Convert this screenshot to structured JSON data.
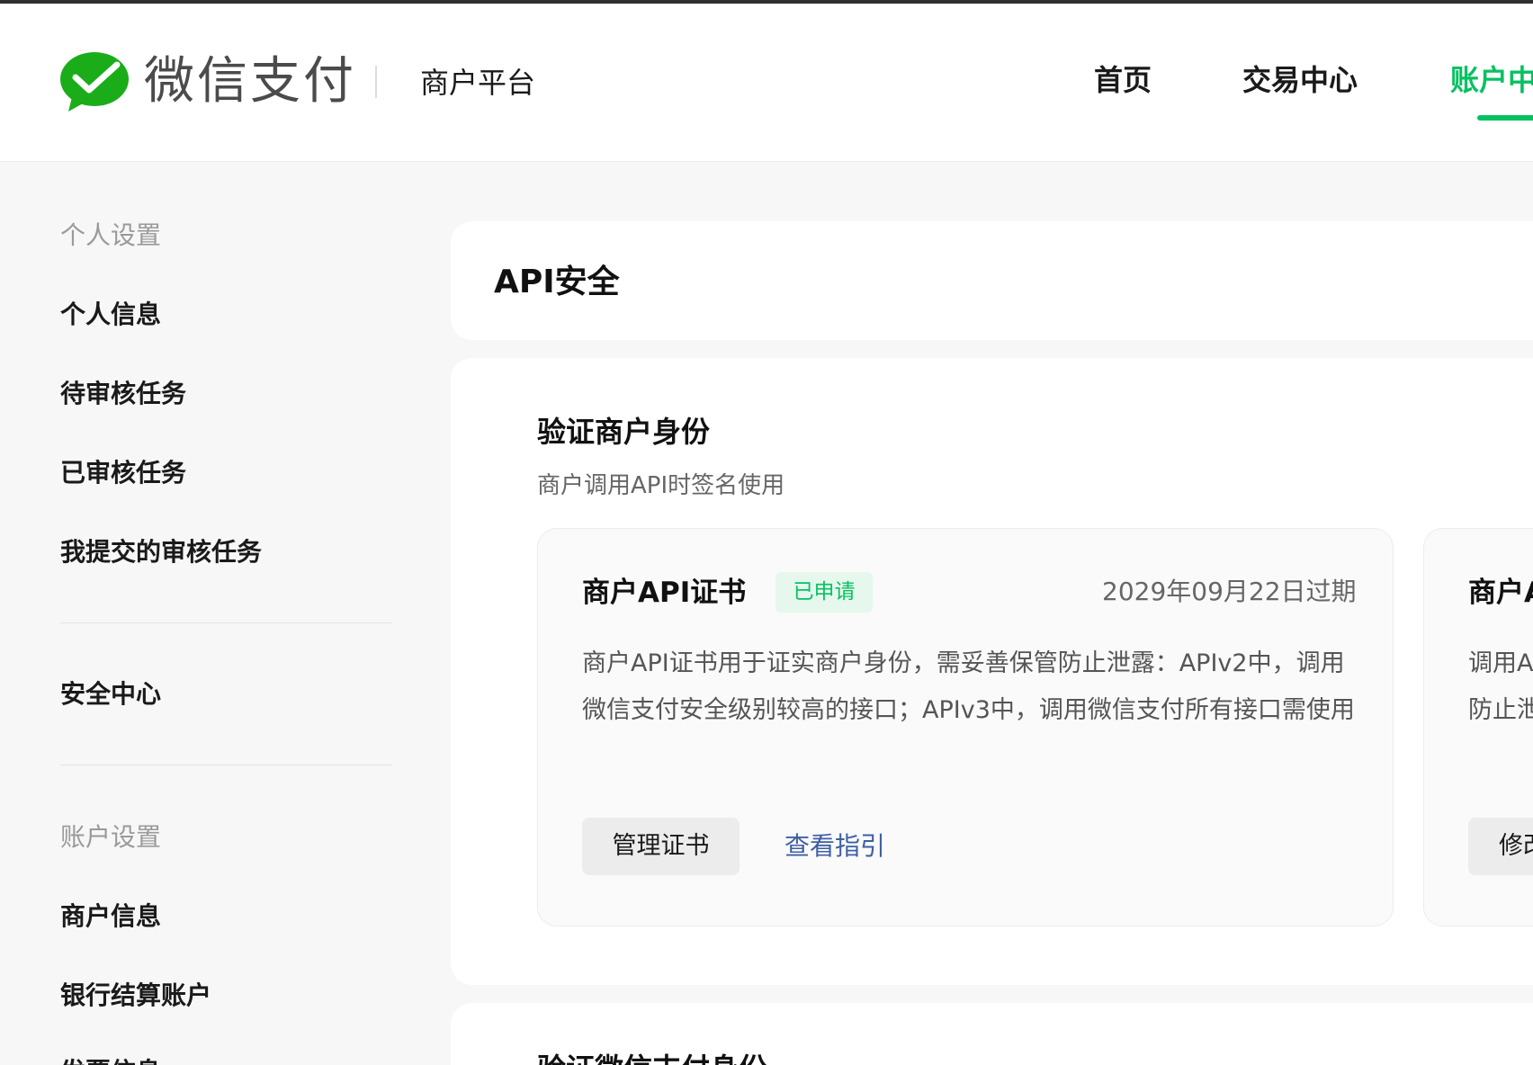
{
  "header": {
    "brand": "微信支付",
    "platform": "商户平台",
    "nav": [
      "首页",
      "交易中心",
      "账户中"
    ],
    "active_nav": 2,
    "accent_color": "#07c160"
  },
  "sidebar": {
    "group_personal": "个人设置",
    "items_personal": [
      "个人信息",
      "待审核任务",
      "已审核任务",
      "我提交的审核任务"
    ],
    "security": "安全中心",
    "group_account": "账户设置",
    "items_account": [
      "商户信息",
      "银行结算账户",
      "发票信息"
    ]
  },
  "page": {
    "title": "API安全"
  },
  "section": {
    "title": "验证商户身份",
    "desc": "商户调用API时签名使用"
  },
  "card1": {
    "title": "商户API证书",
    "status": "已申请",
    "expiry": "2029年09月22日过期",
    "desc": "商户API证书用于证实商户身份，需妥善保管防止泄露：APIv2中，调用微信支付安全级别较高的接口；APIv3中，调用微信支付所有接口需使用",
    "manage_button": "管理证书",
    "guide_link": "查看指引"
  },
  "card2": {
    "title": "商户A",
    "desc_line1": "调用A",
    "desc_line2": "防止泄",
    "button": "修改"
  },
  "section2": {
    "title": "验证微信支付身份"
  }
}
